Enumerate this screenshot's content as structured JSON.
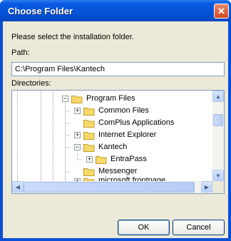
{
  "window": {
    "title": "Choose Folder"
  },
  "labels": {
    "instruction": "Please select the installation folder.",
    "path": "Path:",
    "directories": "Directories:"
  },
  "path_value": "C:\\Program Files\\Kantech",
  "tree": {
    "nodes": [
      {
        "label": "Program Files",
        "expander": "−"
      },
      {
        "label": "Common Files",
        "expander": "+"
      },
      {
        "label": "ComPlus Applications",
        "expander": ""
      },
      {
        "label": "Internet Explorer",
        "expander": "+"
      },
      {
        "label": "Kantech",
        "expander": "−"
      },
      {
        "label": "EntraPass",
        "expander": "+"
      },
      {
        "label": "Messenger",
        "expander": ""
      },
      {
        "label": "microsoft frontpage",
        "expander": "+"
      }
    ]
  },
  "buttons": {
    "ok": "OK",
    "cancel": "Cancel"
  },
  "icons": {
    "close": "close-icon",
    "folder": "folder-icon"
  },
  "colors": {
    "title_bar": "#0553d8",
    "client": "#ece9d8",
    "folder": "#f6d969"
  }
}
